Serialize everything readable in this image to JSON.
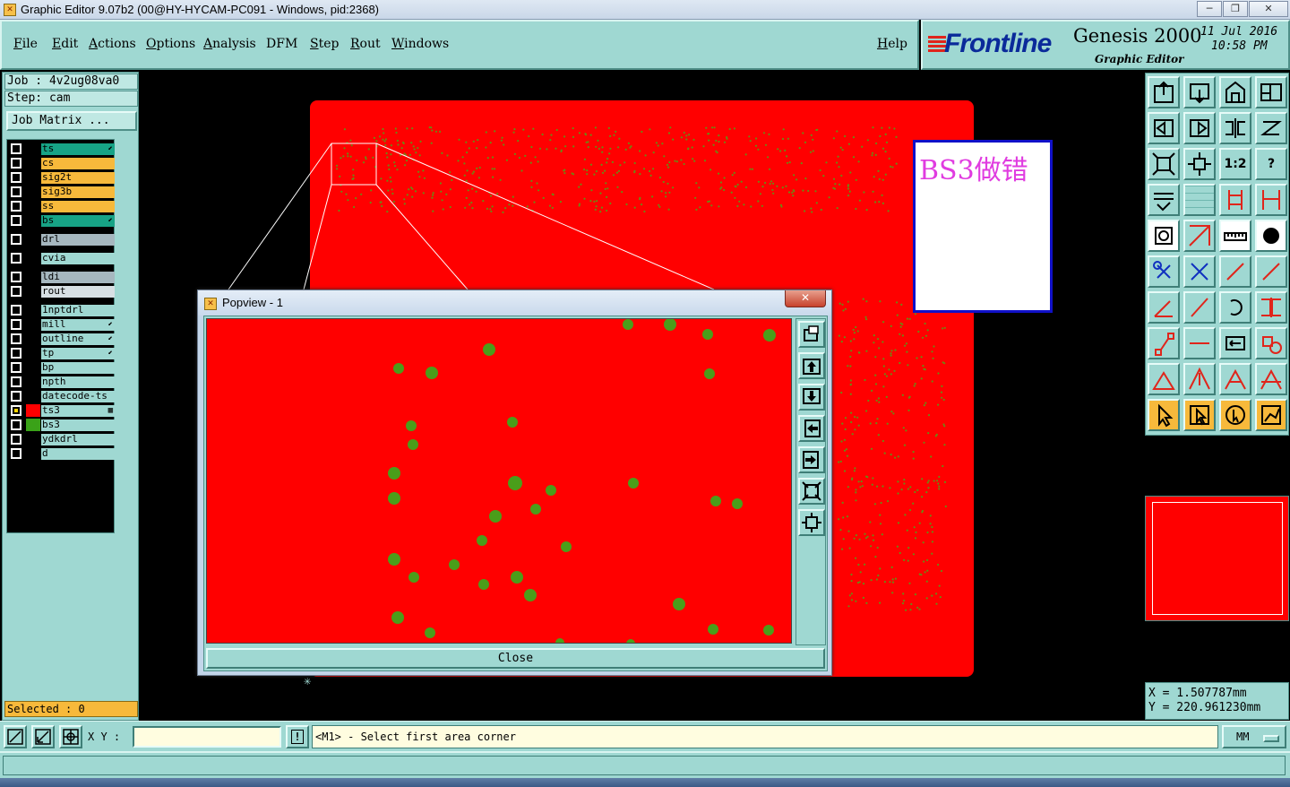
{
  "window": {
    "title": "Graphic Editor 9.07b2 (00@HY-HYCAM-PC091 - Windows, pid:2368)",
    "minimize": "─",
    "maximize": "❐",
    "close": "✕"
  },
  "menu": {
    "file": "File",
    "edit": "Edit",
    "actions": "Actions",
    "options": "Options",
    "analysis": "Analysis",
    "dfm": "DFM",
    "step": "Step",
    "rout": "Rout",
    "windows": "Windows",
    "help": "Help"
  },
  "logo": {
    "brand": "Frontline",
    "product": "Genesis 2000",
    "subtitle": "Graphic Editor",
    "date": "11 Jul 2016",
    "time": "10:58 PM"
  },
  "job": {
    "job_line": "Job : 4v2ug08va0",
    "step_line": "Step: cam",
    "matrix_button": "Job Matrix ...",
    "selected": "Selected : 0"
  },
  "layers": [
    {
      "name": "ts",
      "color": "#17a386",
      "mark": "⬋",
      "swatch": "#000000",
      "checked": false
    },
    {
      "name": "cs",
      "color": "#f7b93b",
      "mark": "",
      "swatch": "#000000",
      "checked": false
    },
    {
      "name": "sig2t",
      "color": "#f7b93b",
      "mark": "",
      "swatch": "#000000",
      "checked": false
    },
    {
      "name": "sig3b",
      "color": "#f7b93b",
      "mark": "",
      "swatch": "#000000",
      "checked": false
    },
    {
      "name": "ss",
      "color": "#f7b93b",
      "mark": "",
      "swatch": "#000000",
      "checked": false
    },
    {
      "name": "bs",
      "color": "#17a386",
      "mark": "⬋",
      "swatch": "#000000",
      "checked": false
    },
    {
      "name": "drl",
      "color": "#a6b7bf",
      "mark": "",
      "swatch": "#000000",
      "checked": false
    },
    {
      "name": "cvia",
      "color": "#9fd8d2",
      "mark": "",
      "swatch": "#000000",
      "checked": false
    },
    {
      "name": "ldi",
      "color": "#a6b7bf",
      "mark": "",
      "swatch": "#000000",
      "checked": false
    },
    {
      "name": "rout",
      "color": "#d8e0e4",
      "mark": "",
      "swatch": "#000000",
      "checked": false
    },
    {
      "name": "1nptdrl",
      "color": "#9fd8d2",
      "mark": "",
      "swatch": "#000000",
      "checked": false
    },
    {
      "name": "mill",
      "color": "#9fd8d2",
      "mark": "⬋",
      "swatch": "#000000",
      "checked": false
    },
    {
      "name": "outline",
      "color": "#9fd8d2",
      "mark": "⬋",
      "swatch": "#000000",
      "checked": false
    },
    {
      "name": "tp",
      "color": "#9fd8d2",
      "mark": "⬋",
      "swatch": "#000000",
      "checked": false
    },
    {
      "name": "bp",
      "color": "#9fd8d2",
      "mark": "",
      "swatch": "#000000",
      "checked": false
    },
    {
      "name": "npth",
      "color": "#9fd8d2",
      "mark": "",
      "swatch": "#000000",
      "checked": false
    },
    {
      "name": "datecode-ts",
      "color": "#9fd8d2",
      "mark": "",
      "swatch": "#000000",
      "checked": false
    },
    {
      "name": "ts3",
      "color": "#9fd8d2",
      "mark": "▦",
      "swatch": "#ff0000",
      "checked": true
    },
    {
      "name": "bs3",
      "color": "#9fd8d2",
      "mark": "",
      "swatch": "#3aa218",
      "checked": false
    },
    {
      "name": "ydkdrl",
      "color": "#9fd8d2",
      "mark": "",
      "swatch": "#000000",
      "checked": false
    },
    {
      "name": "d",
      "color": "#9fd8d2",
      "mark": "",
      "swatch": "#000000",
      "checked": false
    }
  ],
  "canvas": {
    "note": "BS3做错",
    "board_color": "#ff0000",
    "pad_color": "#4a9e1a"
  },
  "popview": {
    "title": "Popview - 1",
    "close_button": "Close",
    "close_x": "✕"
  },
  "coords": {
    "x_line": "X = 1.507787mm",
    "y_line": "Y = 220.961230mm"
  },
  "bottom": {
    "xy_label": "X Y :",
    "xy_value": "",
    "warn": "!",
    "status": "<M1> - Select first area corner",
    "units": "MM"
  }
}
